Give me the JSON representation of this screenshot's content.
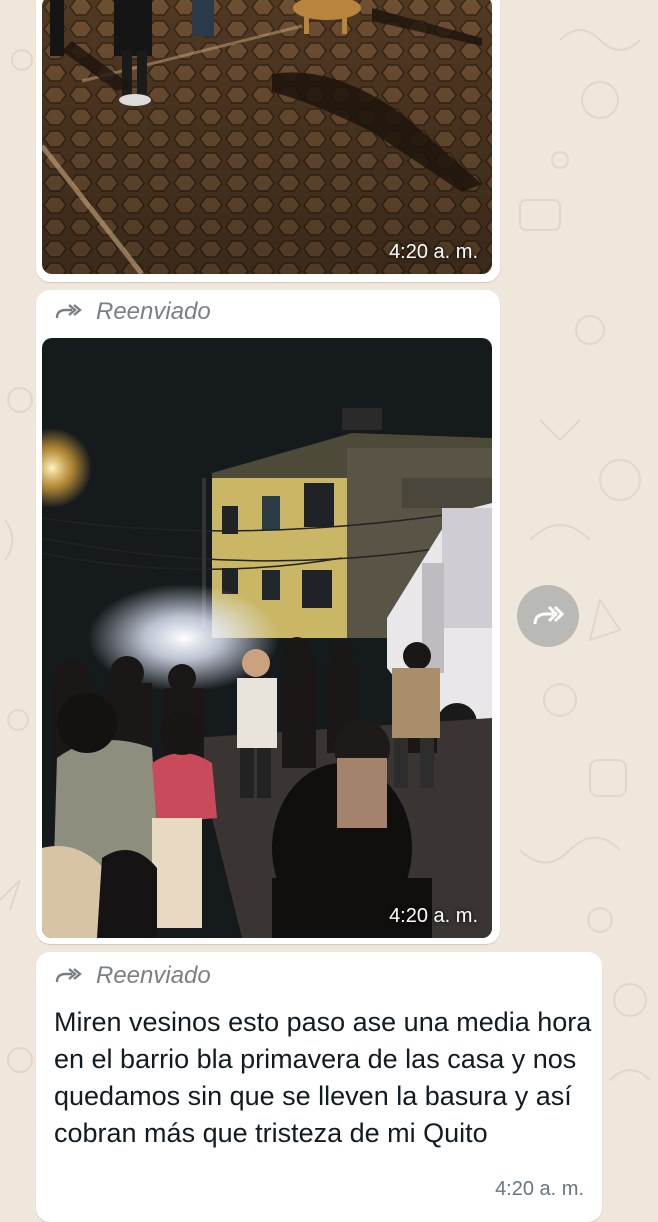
{
  "colors": {
    "wallpaper": "#efe7dc",
    "bubble": "#ffffff",
    "meta_text": "#7a7f83",
    "share_button": "#b9b9b5"
  },
  "messages": [
    {
      "kind": "image",
      "content": "photo-street-night",
      "time": "4:20 a. m."
    },
    {
      "kind": "image",
      "forwarded_label": "Reenviado",
      "content": "photo-garbage-truck-crowd",
      "time": "4:20 a. m."
    },
    {
      "kind": "text",
      "forwarded_label": "Reenviado",
      "text": "Miren vesinos esto paso ase una media hora en el barrio bla primavera de las casa y nos quedamos sin que se lleven la basura y así cobran más que tristeza de mi Quito",
      "time": "4:20 a. m."
    }
  ],
  "icons": {
    "forwarded": "forward-double-arrow-icon",
    "share": "forward-arrow-icon"
  }
}
